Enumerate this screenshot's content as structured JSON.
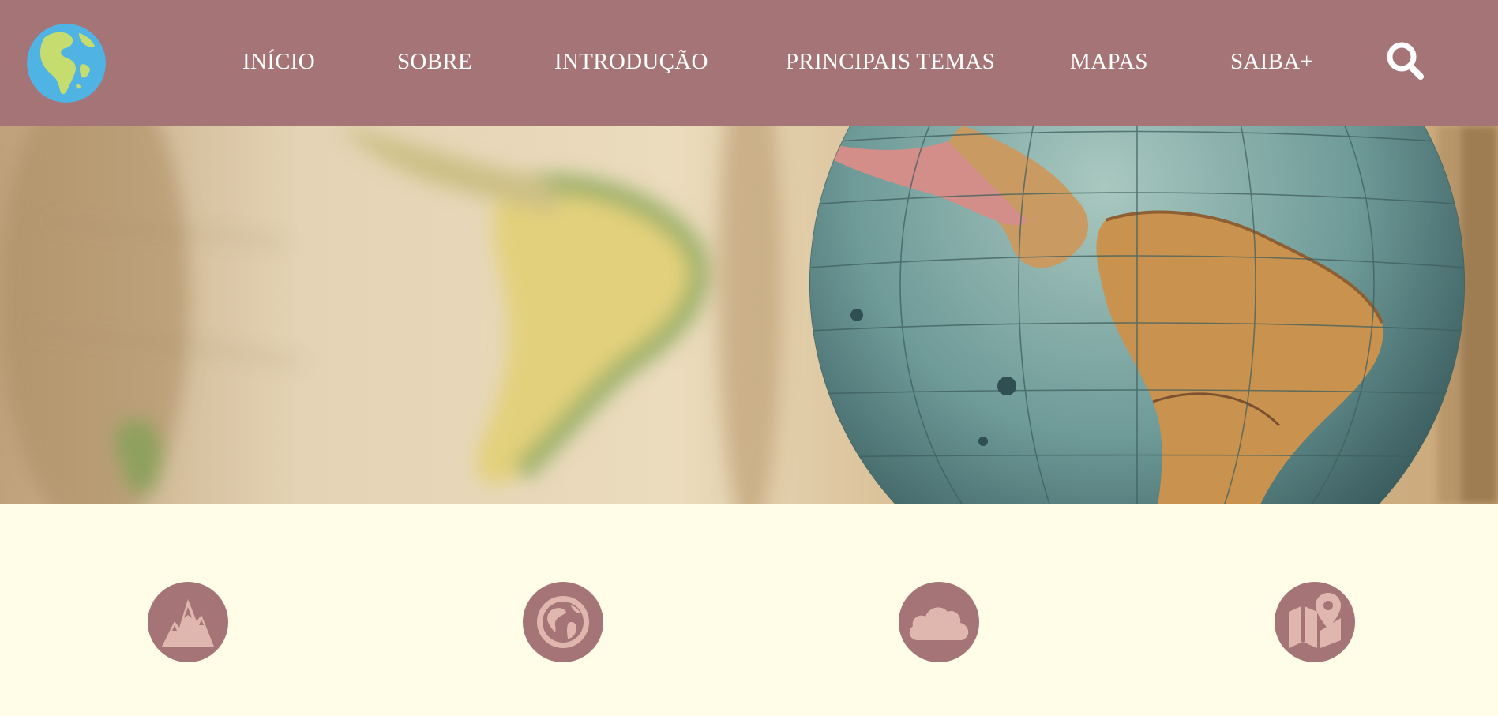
{
  "colors": {
    "navbar_bg": "#a57476",
    "page_bg": "#fffce8",
    "icon_circle": "#a57476",
    "icon_glyph": "#e0b7ae",
    "nav_text": "#ffffff"
  },
  "header": {
    "logo_icon": "globe-logo-icon",
    "nav": [
      {
        "label": "INÍCIO"
      },
      {
        "label": "SOBRE"
      },
      {
        "label": "INTRODUÇÃO"
      },
      {
        "label": "PRINCIPAIS TEMAS"
      },
      {
        "label": "MAPAS"
      },
      {
        "label": "SAIBA+"
      }
    ],
    "search_icon": "search-icon"
  },
  "hero": {
    "image": "antique-globe-banner"
  },
  "features": [
    {
      "icon": "mountain-icon"
    },
    {
      "icon": "earth-icon"
    },
    {
      "icon": "cloud-icon"
    },
    {
      "icon": "map-pin-icon"
    }
  ]
}
